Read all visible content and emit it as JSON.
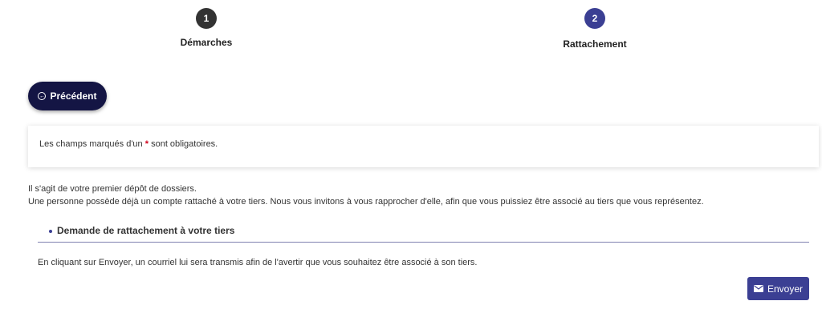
{
  "stepper": {
    "steps": [
      {
        "number": "1",
        "label": "Démarches"
      },
      {
        "number": "2",
        "label": "Rattachement"
      }
    ]
  },
  "actions": {
    "previous_label": "Précédent",
    "send_label": "Envoyer"
  },
  "info": {
    "required_prefix": "Les champs marqués d'un",
    "required_star": "*",
    "required_suffix": "sont obligatoires."
  },
  "intro": {
    "line1": "Il s'agit de votre premier dépôt de dossiers.",
    "line2": "Une personne possède déjà un compte rattaché à votre tiers. Nous vous invitons à vous rapprocher d'elle, afin que vous puissiez être associé au tiers que vous représentez."
  },
  "section": {
    "title": "Demande de rattachement à votre tiers",
    "notice": "En cliquant sur Envoyer, un courriel lui sera transmis afin de l'avertir que vous souhaitez être associé à son tiers."
  },
  "colors": {
    "accent": "#3b3f93",
    "dark_button": "#141544",
    "step_done": "#333333",
    "required": "#d0021b"
  },
  "icons": {
    "previous": "circle-arrow-left-icon",
    "send": "envelope-icon"
  }
}
